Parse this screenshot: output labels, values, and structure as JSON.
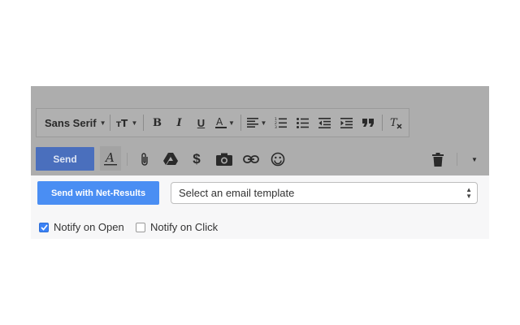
{
  "toolbar": {
    "font": "Sans Serif",
    "icons": [
      "text-size-icon",
      "bold-icon",
      "italic-icon",
      "underline-icon",
      "text-color-icon",
      "align-icon",
      "numbered-list-icon",
      "bulleted-list-icon",
      "indent-less-icon",
      "indent-more-icon",
      "quote-icon",
      "clear-formatting-icon"
    ]
  },
  "compose": {
    "send_label": "Send",
    "icons": [
      "formatting-icon",
      "attach-icon",
      "drive-icon",
      "money-icon",
      "photo-icon",
      "link-icon",
      "emoji-icon",
      "trash-icon",
      "more-options-icon"
    ]
  },
  "netresults": {
    "send_label": "Send with Net-Results",
    "template_placeholder": "Select an email template",
    "notify_open": {
      "label": "Notify on Open",
      "checked": true
    },
    "notify_click": {
      "label": "Notify on Click",
      "checked": false
    }
  },
  "colors": {
    "send": "#4a6fbd",
    "netresults": "#4a8ef3",
    "checkbox": "#3b82f6"
  }
}
